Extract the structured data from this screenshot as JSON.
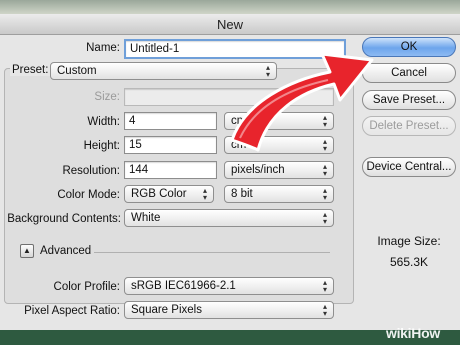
{
  "window": {
    "title": "New"
  },
  "name": {
    "label": "Name:",
    "value": "Untitled-1"
  },
  "preset": {
    "label": "Preset:",
    "value": "Custom"
  },
  "size": {
    "label": "Size:",
    "value": ""
  },
  "width": {
    "label": "Width:",
    "value": "4",
    "unit": "cm"
  },
  "height": {
    "label": "Height:",
    "value": "15",
    "unit": "cm"
  },
  "resolution": {
    "label": "Resolution:",
    "value": "144",
    "unit": "pixels/inch"
  },
  "color_mode": {
    "label": "Color Mode:",
    "value": "RGB Color",
    "depth": "8 bit"
  },
  "background": {
    "label": "Background Contents:",
    "value": "White"
  },
  "advanced": {
    "label": "Advanced"
  },
  "color_profile": {
    "label": "Color Profile:",
    "value": "sRGB IEC61966-2.1"
  },
  "pixel_aspect": {
    "label": "Pixel Aspect Ratio:",
    "value": "Square Pixels"
  },
  "buttons": {
    "ok": "OK",
    "cancel": "Cancel",
    "save_preset": "Save Preset...",
    "delete_preset": "Delete Preset...",
    "device_central": "Device Central..."
  },
  "image_size": {
    "label": "Image Size:",
    "value": "565.3K"
  },
  "watermark": {
    "part1": "wiki",
    "part2": "How"
  },
  "colors": {
    "accent_arrow": "#e8242c",
    "ok_button": "#6da5ec",
    "focus_ring": "#6f9fd9"
  }
}
